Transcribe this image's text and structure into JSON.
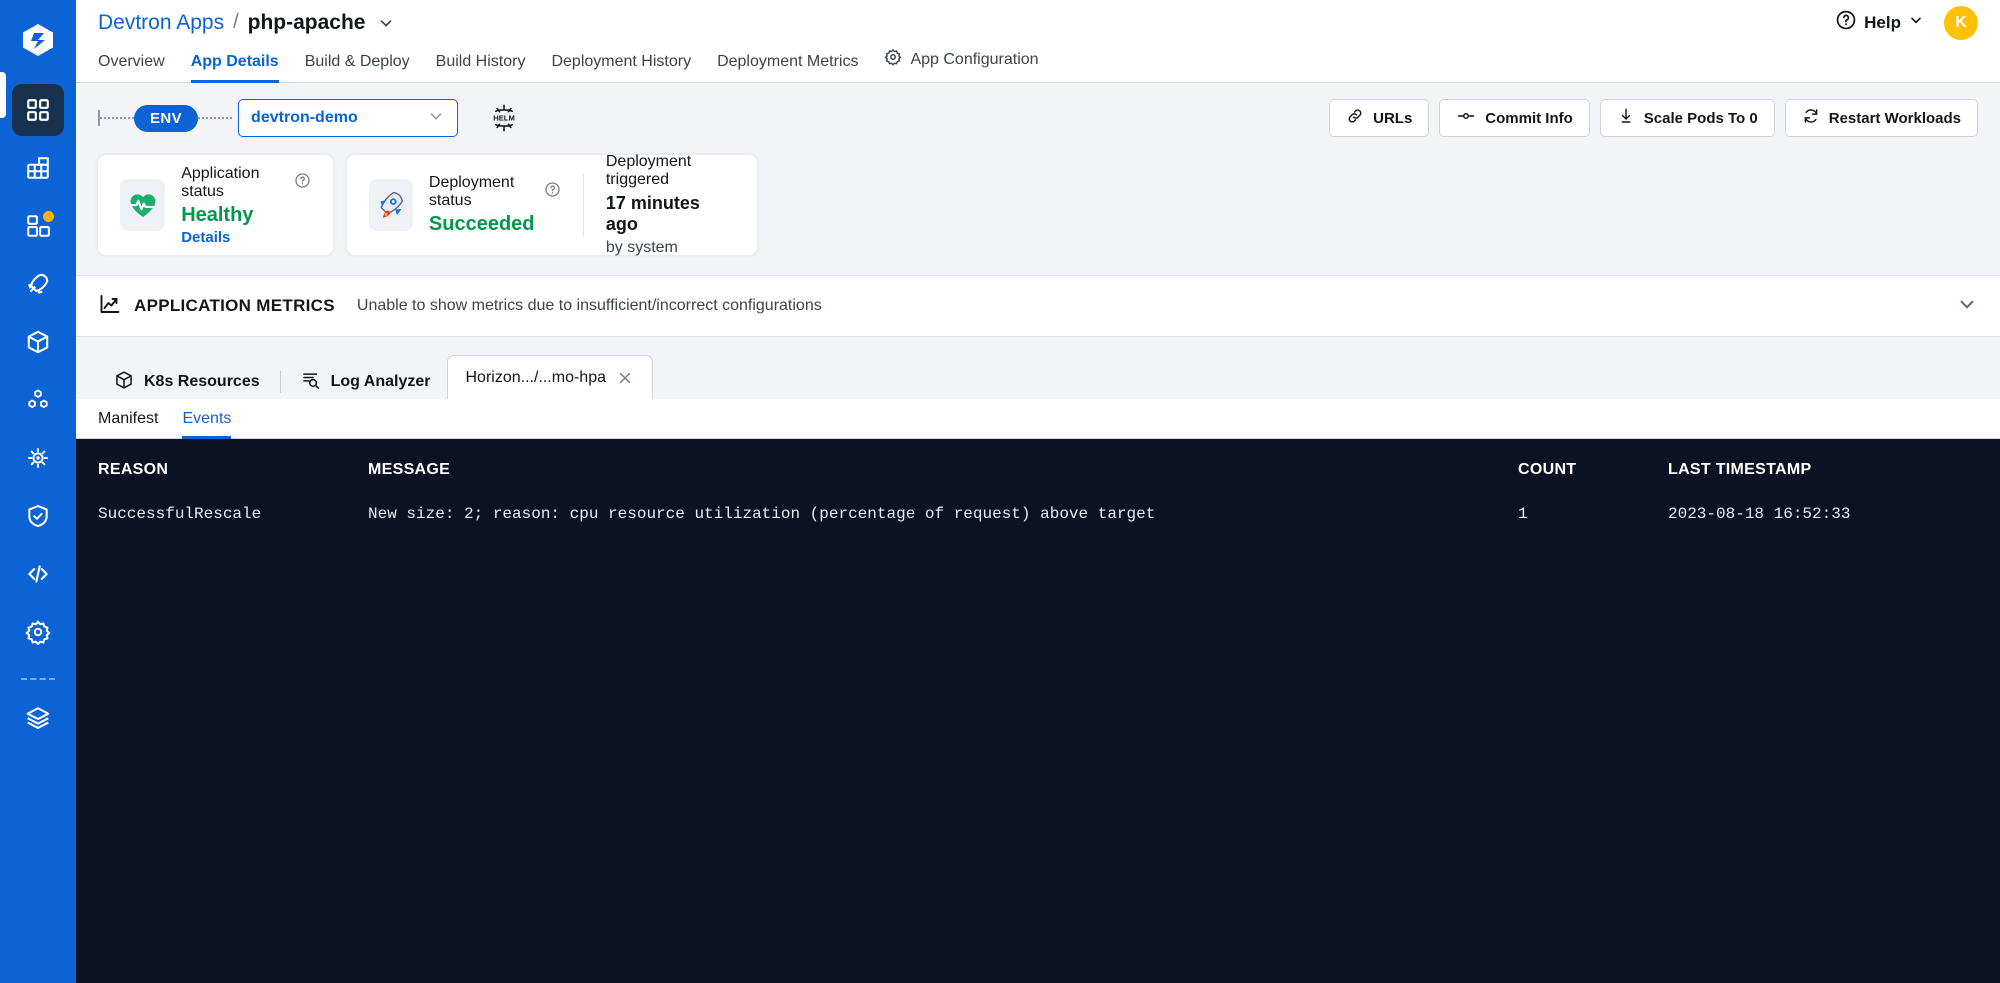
{
  "sidebar": {
    "logo_name": "devtron-logo",
    "items": [
      {
        "name": "applications",
        "icon": "grid-tiles-icon",
        "active": true,
        "badge": false
      },
      {
        "name": "chart-store",
        "icon": "table-grid-icon",
        "active": false,
        "badge": false
      },
      {
        "name": "jobs",
        "icon": "blocks-icon",
        "active": false,
        "badge": true
      },
      {
        "name": "deployment",
        "icon": "rocket-icon",
        "active": false,
        "badge": false
      },
      {
        "name": "resource-browser",
        "icon": "cube-icon",
        "active": false,
        "badge": false
      },
      {
        "name": "clusters",
        "icon": "hexagons-icon",
        "active": false,
        "badge": false
      },
      {
        "name": "kubernetes",
        "icon": "helm-wheel-icon",
        "active": false,
        "badge": false
      },
      {
        "name": "security",
        "icon": "shield-check-icon",
        "active": false,
        "badge": false
      },
      {
        "name": "code",
        "icon": "code-brackets-icon",
        "active": false,
        "badge": false
      },
      {
        "name": "global-configurations",
        "icon": "gear-icon",
        "active": false,
        "badge": false
      },
      {
        "name": "stacks",
        "icon": "layers-icon",
        "active": false,
        "badge": false
      }
    ]
  },
  "header": {
    "breadcrumb_root": "Devtron Apps",
    "breadcrumb_separator": "/",
    "app_name": "php-apache",
    "app_caret_icon": "chevron-down-icon",
    "help_label": "Help",
    "help_icon": "question-circle-icon",
    "help_caret_icon": "chevron-down-icon",
    "avatar_initial": "K",
    "avatar_color": "#ffc107"
  },
  "nav_tabs": [
    {
      "label": "Overview",
      "active": false,
      "icon": null
    },
    {
      "label": "App Details",
      "active": true,
      "icon": null
    },
    {
      "label": "Build & Deploy",
      "active": false,
      "icon": null
    },
    {
      "label": "Build History",
      "active": false,
      "icon": null
    },
    {
      "label": "Deployment History",
      "active": false,
      "icon": null
    },
    {
      "label": "Deployment Metrics",
      "active": false,
      "icon": null
    },
    {
      "label": "App Configuration",
      "active": false,
      "icon": "gear-icon"
    }
  ],
  "env_bar": {
    "env_badge": "ENV",
    "env_selected": "devtron-demo",
    "env_caret_icon": "chevron-down-icon",
    "helm_icon_label": "HELM",
    "actions": [
      {
        "label": "URLs",
        "icon": "link-icon"
      },
      {
        "label": "Commit Info",
        "icon": "commit-icon"
      },
      {
        "label": "Scale Pods To 0",
        "icon": "scale-down-icon"
      },
      {
        "label": "Restart Workloads",
        "icon": "refresh-icon"
      }
    ]
  },
  "status_cards": {
    "application": {
      "title": "Application status",
      "help_icon": "question-circle-icon",
      "status": "Healthy",
      "status_color": "#00994b",
      "details_link": "Details",
      "icon": "heartbeat-icon"
    },
    "deployment": {
      "title": "Deployment status",
      "help_icon": "question-circle-icon",
      "status": "Succeeded",
      "status_color": "#00994b",
      "icon": "rocket-icon",
      "trigger_label": "Deployment triggered",
      "trigger_time": "17 minutes ago",
      "trigger_by": "by system"
    }
  },
  "metrics": {
    "icon": "trend-chart-icon",
    "label": "APPLICATION METRICS",
    "message": "Unable to show metrics due to insufficient/incorrect configurations",
    "collapse_icon": "chevron-down-icon"
  },
  "resource_tabs": [
    {
      "label": "K8s Resources",
      "icon": "cube-icon",
      "selected": false,
      "closable": false
    },
    {
      "label": "Log Analyzer",
      "icon": "log-search-icon",
      "selected": false,
      "closable": false
    },
    {
      "label": "Horizon.../...mo-hpa",
      "icon": null,
      "selected": true,
      "closable": true,
      "close_icon": "close-icon"
    }
  ],
  "sub_tabs": [
    {
      "label": "Manifest",
      "active": false
    },
    {
      "label": "Events",
      "active": true
    }
  ],
  "events_table": {
    "columns": [
      "REASON",
      "MESSAGE",
      "COUNT",
      "LAST TIMESTAMP"
    ],
    "rows": [
      {
        "reason": "SuccessfulRescale",
        "message": "New size: 2; reason: cpu resource utilization (percentage of request) above target",
        "count": "1",
        "last_timestamp": "2023-08-18 16:52:33"
      }
    ]
  }
}
